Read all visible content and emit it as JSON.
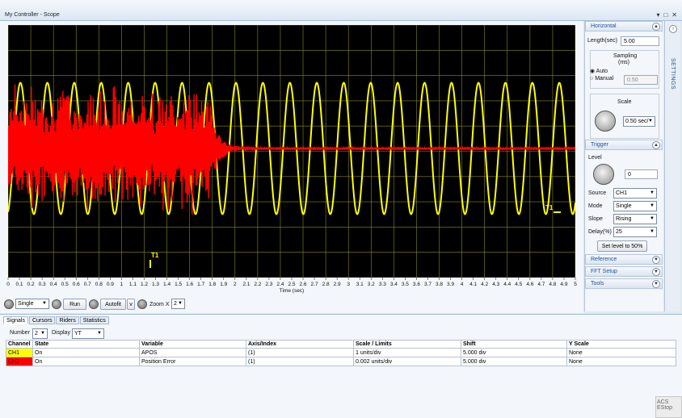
{
  "window": {
    "title": "My Controller - Scope",
    "buttons": [
      "▾",
      "□",
      "✕"
    ]
  },
  "plot": {
    "background": "#000000",
    "grid_color": "#8a8a1e",
    "trigger_marker": "T1",
    "trigger_level_marker": "T1",
    "x_ticks": [
      "0",
      "0.1",
      "0.2",
      "0.3",
      "0.4",
      "0.5",
      "0.6",
      "0.7",
      "0.8",
      "0.9",
      "1",
      "1.1",
      "1.2",
      "1.3",
      "1.4",
      "1.5",
      "1.6",
      "1.7",
      "1.8",
      "1.9",
      "2",
      "2.1",
      "2.2",
      "2.3",
      "2.4",
      "2.5",
      "2.6",
      "2.7",
      "2.8",
      "2.9",
      "3",
      "3.1",
      "3.2",
      "3.3",
      "3.4",
      "3.5",
      "3.6",
      "3.7",
      "3.8",
      "3.9",
      "4",
      "4.1",
      "4.2",
      "4.3",
      "4.4",
      "4.5",
      "4.6",
      "4.7",
      "4.8",
      "4.9",
      "5"
    ],
    "x_label": "Time (sec)"
  },
  "chart_data": {
    "type": "line",
    "x_range": [
      0,
      5
    ],
    "xlabel": "Time (sec)",
    "grid": true,
    "series": [
      {
        "name": "CH1",
        "variable": "APOS",
        "color": "#ffff00",
        "kind": "sine",
        "period_sec": 0.2375,
        "amplitude_div": 2.6,
        "offset_div": 0
      },
      {
        "name": "CH2",
        "variable": "Position Error",
        "color": "#ff0000",
        "kind": "noise_decay",
        "amplitude_div": 2.8,
        "settle_sec": 1.95
      }
    ]
  },
  "controls": {
    "mode_value": "Single",
    "run_label": "Run",
    "autofit_label": "Autofit",
    "v_label": "v",
    "zoom_label": "Zoom X",
    "zoom_value": "2"
  },
  "horizontal": {
    "header": "Horizontal",
    "length_label": "Length(sec)",
    "length_value": "5.00",
    "sampling_label": "Sampling",
    "sampling_unit": "(ms)",
    "auto_label": "Auto",
    "manual_label": "Manual",
    "manual_value": "0.50",
    "scale_label": "Scale",
    "scale_value": "0.50 sec/"
  },
  "trigger": {
    "header": "Trigger",
    "level_label": "Level",
    "level_value": "0",
    "source_label": "Source",
    "source_value": "CH1",
    "mode_label": "Mode",
    "mode_value": "Single",
    "slope_label": "Slope",
    "slope_value": "Rising",
    "delay_label": "Delay(%)",
    "delay_value": "25",
    "set_level_button": "Set level to 50%"
  },
  "collapsed_sections": [
    "Reference",
    "FFT Setup",
    "Tools"
  ],
  "settings_tab": "SETTINGS",
  "bottom": {
    "tabs": [
      "Signals",
      "Cursors",
      "Riders",
      "Statistics"
    ],
    "number_label": "Number",
    "number_value": "2",
    "display_label": "Display",
    "display_value": "YT",
    "columns": [
      "Channel",
      "State",
      "Variable",
      "Axis/Index",
      "Scale / Limits",
      "Shift",
      "Y Scale"
    ],
    "rows": [
      {
        "channel": "CH1",
        "color": "#ffff00",
        "state": "On",
        "variable": "APOS",
        "axis": "(1)",
        "scale": "1 units/div",
        "shift": "5.000 div",
        "yscale": "None"
      },
      {
        "channel": "CH2",
        "color": "#ff0000",
        "state": "On",
        "variable": "Position Error",
        "axis": "(1)",
        "scale": "0.002 units/div",
        "shift": "5.000 div",
        "yscale": "None"
      }
    ]
  },
  "estop": "ACS EStop"
}
